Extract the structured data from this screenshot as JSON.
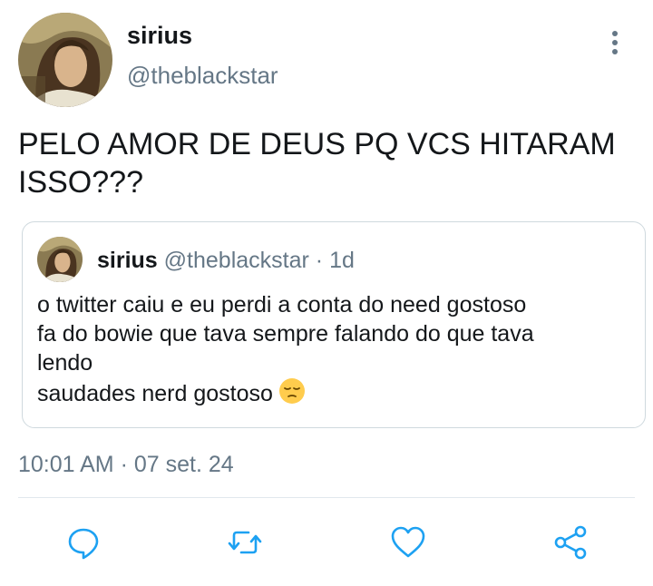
{
  "tweet": {
    "author_name": "sirius",
    "author_handle": "@theblackstar",
    "text": "PELO AMOR DE DEUS PQ VCS HITARAM ISSO???",
    "timestamp": "10:01 AM · 07 set. 24"
  },
  "quoted": {
    "author_name": "sirius",
    "author_handle": "@theblackstar",
    "age": "1d",
    "lines": [
      "o twitter caiu e eu perdi a conta do need gostoso",
      "fa do bowie que tava sempre falando do que tava",
      "lendo",
      "saudades nerd gostoso"
    ],
    "emoji": "pensive-face"
  },
  "actions": [
    "reply-icon",
    "retweet-icon",
    "like-icon",
    "share-icon"
  ],
  "colors": {
    "text": "#14171a",
    "secondary": "#657786",
    "icon": "#1da1f2",
    "border": "#cfd9de"
  }
}
